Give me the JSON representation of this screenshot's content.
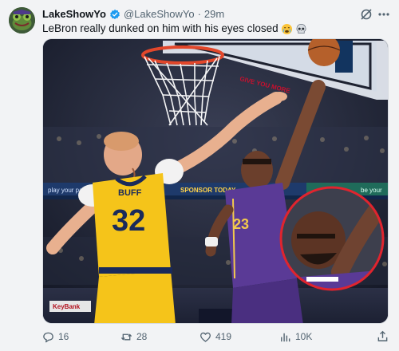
{
  "post": {
    "display_name": "LakeShowYo",
    "handle": "@LakeShowYo",
    "separator": "·",
    "timestamp": "29m",
    "text": "LeBron really dunked on him with his eyes closed"
  },
  "media": {
    "jersey_name": "BUFF",
    "jersey_number": "32",
    "lakers_number": "23",
    "banner_left": "play your pa",
    "banner_mid": "SPONSOR TODAY",
    "banner_right": "be your",
    "sponsor_sign": "KeyBank",
    "backboard_text": "GIVE YOU MORE"
  },
  "actions": {
    "replies": "16",
    "reposts": "28",
    "likes": "419",
    "views": "10K"
  },
  "colors": {
    "accent": "#1d9bf0",
    "muted": "#536471",
    "pacers_yellow": "#f5c41a",
    "lakers_purple": "#5a3a96",
    "highlight_circle": "#e0242e"
  },
  "icons": [
    "avatar",
    "verified-icon",
    "grok-icon",
    "more-icon",
    "crying-emoji",
    "skull-emoji",
    "reply-icon",
    "repost-icon",
    "like-icon",
    "views-icon",
    "share-icon"
  ]
}
